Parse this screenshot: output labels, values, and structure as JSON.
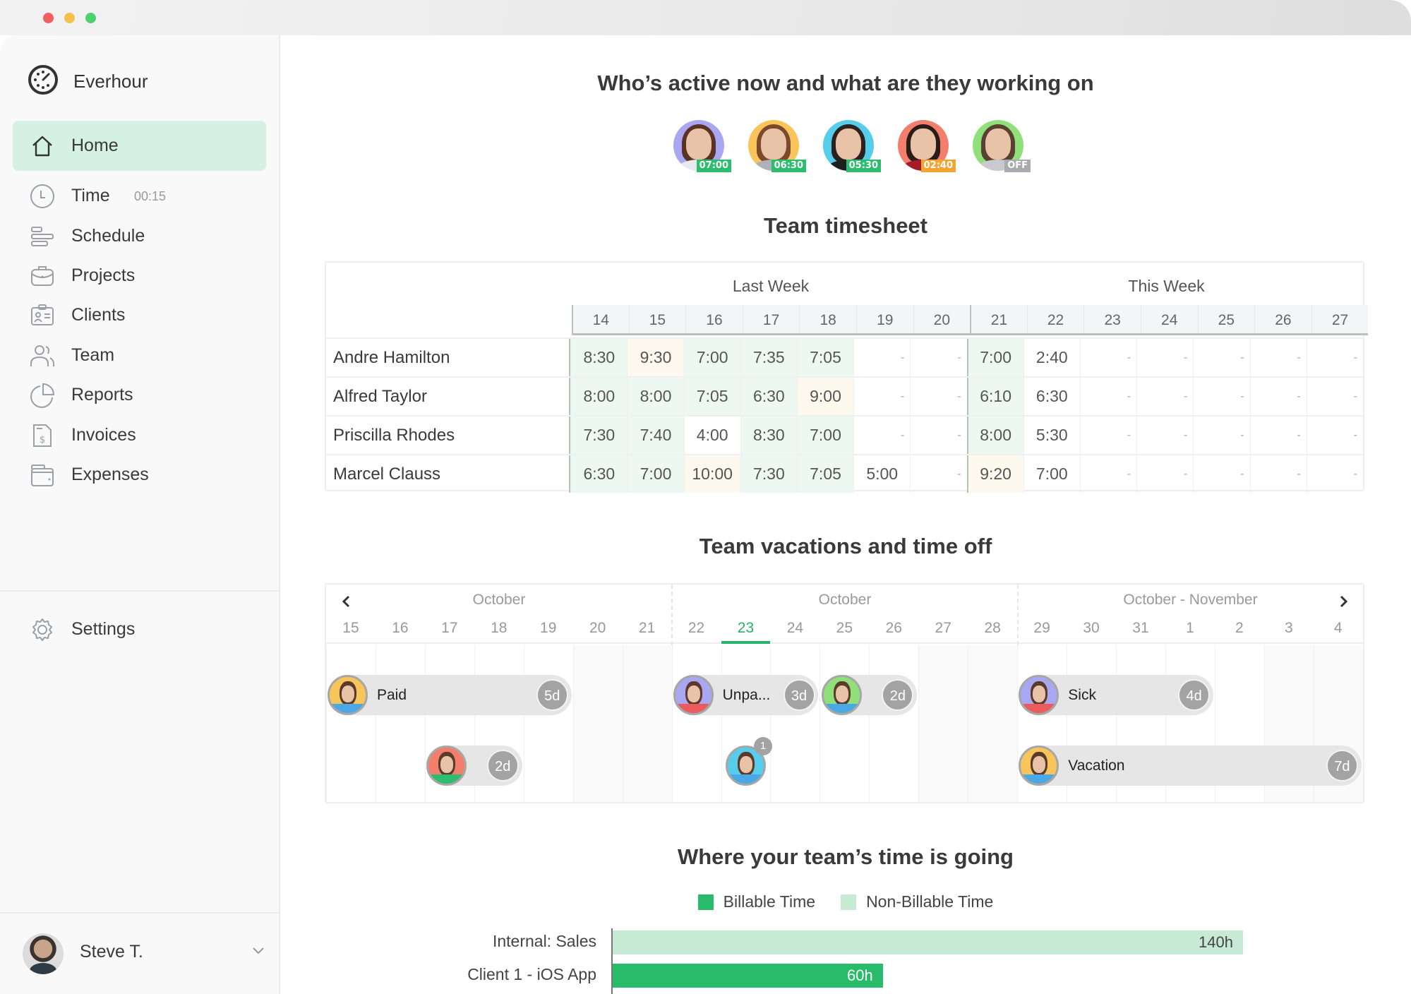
{
  "app": {
    "name": "Everhour"
  },
  "window": {
    "controls": [
      "close",
      "minimize",
      "maximize"
    ]
  },
  "sidebar": {
    "items": [
      {
        "label": "Home",
        "icon": "home-icon",
        "active": true
      },
      {
        "label": "Time",
        "sub": "00:15",
        "icon": "clock-icon"
      },
      {
        "label": "Schedule",
        "icon": "schedule-icon"
      },
      {
        "label": "Projects",
        "icon": "briefcase-icon"
      },
      {
        "label": "Clients",
        "icon": "id-card-icon"
      },
      {
        "label": "Team",
        "icon": "team-icon"
      },
      {
        "label": "Reports",
        "icon": "pie-chart-icon"
      },
      {
        "label": "Invoices",
        "icon": "invoice-icon"
      },
      {
        "label": "Expenses",
        "icon": "wallet-icon"
      }
    ],
    "settings": {
      "label": "Settings",
      "icon": "gear-icon"
    },
    "user": {
      "name": "Steve T."
    }
  },
  "active_now": {
    "title": "Who’s active now and what are they working on",
    "people": [
      {
        "badge": "07:00",
        "bg": "#a9a6f2",
        "badge_color": "#2dbd6e",
        "hair": "#5a3324",
        "shirt": "#e8e8ee"
      },
      {
        "badge": "06:30",
        "bg": "#f7c55a",
        "badge_color": "#2dbd6e",
        "hair": "#7a4a2a",
        "shirt": "#b0b0b8"
      },
      {
        "badge": "05:30",
        "bg": "#56cdea",
        "badge_color": "#2dbd6e",
        "hair": "#2a2220",
        "shirt": "#1e1e1e"
      },
      {
        "badge": "02:40",
        "bg": "#f47e6c",
        "badge_color": "#f3a531",
        "hair": "#2a1c18",
        "shirt": "#a41b2c"
      },
      {
        "badge": "OFF",
        "bg": "#8fe07a",
        "badge_color": "#a8acb0",
        "hair": "#5a4030",
        "shirt": "#c9c9cf"
      }
    ]
  },
  "timesheet": {
    "title": "Team timesheet",
    "weeks": [
      "Last Week",
      "This Week"
    ],
    "days": [
      "14",
      "15",
      "16",
      "17",
      "18",
      "19",
      "20",
      "21",
      "22",
      "23",
      "24",
      "25",
      "26",
      "27"
    ],
    "rows": [
      {
        "name": "Andre Hamilton",
        "values": [
          "8:30",
          "9:30",
          "7:00",
          "7:35",
          "7:05",
          "-",
          "-",
          "7:00",
          "2:40",
          "-",
          "-",
          "-",
          "-",
          "-"
        ],
        "tint": [
          "g",
          "y",
          "g",
          "g",
          "g",
          "",
          "",
          "g",
          "",
          "",
          "",
          "",
          "",
          ""
        ]
      },
      {
        "name": "Alfred Taylor",
        "values": [
          "8:00",
          "8:00",
          "7:05",
          "6:30",
          "9:00",
          "-",
          "-",
          "6:10",
          "6:30",
          "-",
          "-",
          "-",
          "-",
          "-"
        ],
        "tint": [
          "g",
          "g",
          "g",
          "g",
          "y",
          "",
          "",
          "g",
          "",
          "",
          "",
          "",
          "",
          ""
        ]
      },
      {
        "name": "Priscilla Rhodes",
        "values": [
          "7:30",
          "7:40",
          "4:00",
          "8:30",
          "7:00",
          "-",
          "-",
          "8:00",
          "5:30",
          "-",
          "-",
          "-",
          "-",
          "-"
        ],
        "tint": [
          "g",
          "g",
          "",
          "g",
          "g",
          "",
          "",
          "g",
          "",
          "",
          "",
          "",
          "",
          ""
        ]
      },
      {
        "name": "Marcel Clauss",
        "values": [
          "6:30",
          "7:00",
          "10:00",
          "7:30",
          "7:05",
          "5:00",
          "-",
          "9:20",
          "7:00",
          "-",
          "-",
          "-",
          "-",
          "-"
        ],
        "tint": [
          "g",
          "g",
          "y",
          "g",
          "g",
          "",
          "",
          "y",
          "",
          "",
          "",
          "",
          "",
          ""
        ]
      }
    ]
  },
  "vacations": {
    "title": "Team vacations and time off",
    "months": [
      "October",
      "October",
      "October - November"
    ],
    "days": [
      "15",
      "16",
      "17",
      "18",
      "19",
      "20",
      "21",
      "22",
      "23",
      "24",
      "25",
      "26",
      "27",
      "28",
      "29",
      "30",
      "31",
      "1",
      "2",
      "3",
      "4"
    ],
    "today": "23",
    "weekends": [
      5,
      6,
      12,
      13,
      19,
      20
    ],
    "entries": [
      {
        "label": "Paid",
        "days_label": "5d",
        "start": 0,
        "length": 5,
        "lane": 0,
        "bg": "#f7c55a",
        "stripe": "#4aa8e6"
      },
      {
        "label": "",
        "days_label": "2d",
        "start": 2,
        "length": 2,
        "lane": 1,
        "bg": "#f47e6c",
        "stripe": "#2dbd6e"
      },
      {
        "label": "Unpa...",
        "days_label": "3d",
        "start": 7,
        "length": 3,
        "lane": 0,
        "bg": "#a9a6f2",
        "stripe": "#ec5b5b"
      },
      {
        "label": "",
        "days_label": "2d",
        "start": 10,
        "length": 2,
        "lane": 0,
        "bg": "#8fe07a",
        "stripe": "#4aa8e6"
      },
      {
        "label": "",
        "days_label": "",
        "start": 8,
        "length": 1,
        "lane": 1,
        "bg": "#56cdea",
        "stripe": "#4aa8e6",
        "count": "1"
      },
      {
        "label": "Sick",
        "days_label": "4d",
        "start": 14,
        "length": 4,
        "lane": 0,
        "bg": "#a9a6f2",
        "stripe": "#ec5b5b"
      },
      {
        "label": "Vacation",
        "days_label": "7d",
        "start": 14,
        "length": 7,
        "lane": 1,
        "bg": "#f7c55a",
        "stripe": "#4aa8e6"
      }
    ]
  },
  "time_going": {
    "title": "Where your team’s time is going"
  },
  "chart_data": {
    "type": "bar",
    "orientation": "horizontal",
    "title": "Where your team’s time is going",
    "legend": [
      {
        "name": "Billable Time",
        "color": "#27bb6a"
      },
      {
        "name": "Non-Billable Time",
        "color": "#c7ead4"
      }
    ],
    "legend_position": "top-center",
    "categories": [
      "Internal: Sales",
      "Client 1 - iOS App"
    ],
    "bars": [
      {
        "category": "Internal: Sales",
        "series": "Non-Billable Time",
        "value": 140,
        "label": "140h"
      },
      {
        "category": "Client 1 - iOS App",
        "series": "Billable Time",
        "value": 60,
        "label": "60h"
      }
    ],
    "unit": "h",
    "xlim": [
      0,
      140
    ],
    "grid": false
  },
  "colors": {
    "accent": "#27bb6a",
    "active_nav_bg": "#d5f1e3",
    "cell_green": "#eef8f3",
    "cell_yellow": "#fef9ee"
  }
}
